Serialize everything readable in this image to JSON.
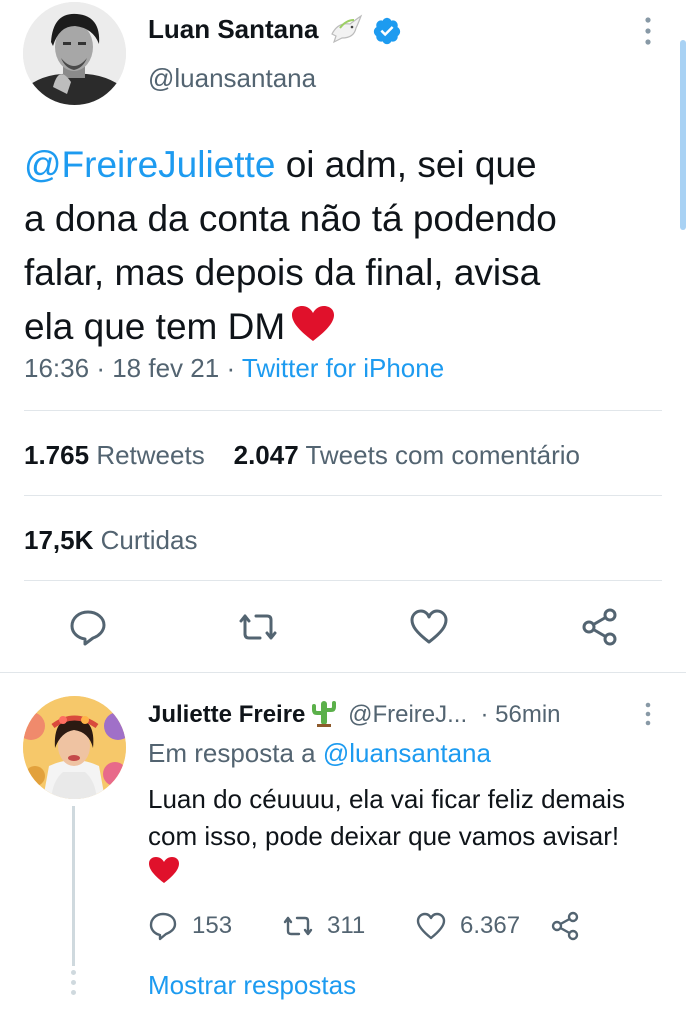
{
  "main_tweet": {
    "author_name": "Luan Santana",
    "author_handle": "@luansantana",
    "mention": "@FreireJuliette",
    "text_line1": " oi adm, sei que",
    "text_line2": "a dona da conta não tá podendo",
    "text_line3": "falar, mas depois da final, avisa",
    "text_line4": "ela que tem DM",
    "time": "16:36",
    "date": "18 fev 21",
    "source": "Twitter for iPhone",
    "retweets_count": "1.765",
    "retweets_label": "Retweets",
    "quotes_count": "2.047",
    "quotes_label": "Tweets com comentário",
    "likes_count": "17,5K",
    "likes_label": "Curtidas"
  },
  "reply": {
    "author_name": "Juliette Freire",
    "author_handle": "@FreireJ...",
    "time": "56min",
    "in_reply_prefix": "Em resposta a",
    "in_reply_to": "@luansantana",
    "text_line1": "Luan do céuuuu, ela vai ficar feliz demais",
    "text_line2": "com isso, pode deixar que vamos avisar!",
    "reply_count": "153",
    "retweet_count": "311",
    "like_count": "6.367",
    "show_replies": "Mostrar respostas"
  },
  "icons": {
    "verified": "verified-badge-icon",
    "dove": "dove-emoji-icon",
    "cactus": "cactus-emoji-icon",
    "heart": "red-heart-emoji-icon",
    "reply": "reply-icon",
    "retweet": "retweet-icon",
    "like": "like-icon",
    "share": "share-icon"
  },
  "colors": {
    "accent": "#1d9bf0",
    "text": "#0f1419",
    "secondary": "#536471",
    "heart": "#e0112b",
    "divider": "#e1e6ea"
  }
}
